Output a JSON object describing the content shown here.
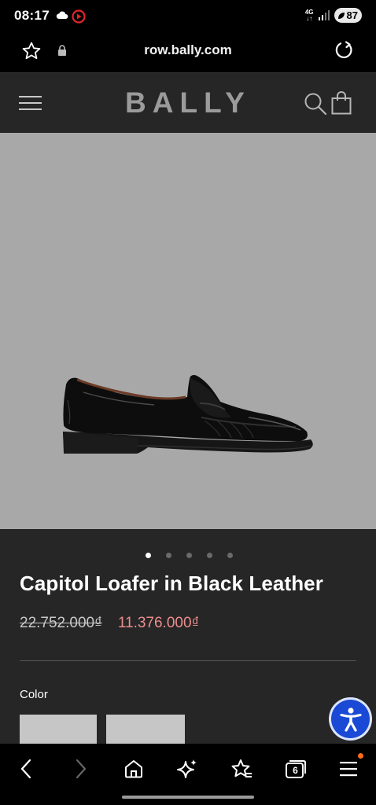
{
  "status_bar": {
    "time": "08:17",
    "network": "4G",
    "battery": "87",
    "icons": [
      "cloud-icon",
      "record-icon",
      "signal-icon",
      "battery-icon"
    ]
  },
  "browser": {
    "url": "row.bally.com",
    "icons": [
      "star-icon",
      "lock-icon",
      "reload-icon"
    ]
  },
  "site_header": {
    "brand": "BALLY",
    "icons": [
      "hamburger-menu-icon",
      "search-icon",
      "shopping-bag-icon"
    ]
  },
  "product": {
    "image_alt": "black leather penny loafer",
    "carousel": {
      "total": 5,
      "active_index": 0
    },
    "title": "Capitol Loafer in Black Leather",
    "price_original": "22.752.000₫",
    "price_sale": "11.376.000₫",
    "color_label": "Color",
    "swatch_count": 2
  },
  "bottom_nav": {
    "tabs_count": "6",
    "items": [
      "back-icon",
      "forward-icon",
      "home-icon",
      "sparkle-icon",
      "bookmark-star-icon",
      "tabs-icon",
      "menu-icon"
    ]
  },
  "colors": {
    "background": "#262626",
    "image_bg": "#a8a8a8",
    "sale_price": "#ef8d8d",
    "accessibility": "#1a49d6",
    "notification": "#ff6a1a"
  }
}
